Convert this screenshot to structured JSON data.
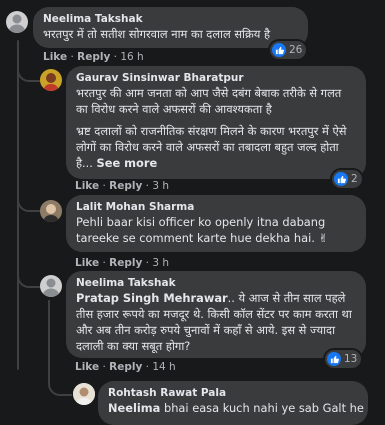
{
  "comments": [
    {
      "author": "Neelima Takshak",
      "text": "भरतपुर में तो सतीश सोगरवाल नाम का दलाल सक्रिय है",
      "like_label": "Like",
      "reply_label": "Reply",
      "time": "16 h",
      "reactions": "26"
    },
    {
      "author": "Gaurav Sinsinwar Bharatpur",
      "paragraph1": "भरतपुर की आम जनता को आप जैसे दबंग बेबाक तरीके से गलत का विरोध करने वाले अफसरों की आवश्यकता है",
      "paragraph2": "भ्रष्ट दलालों को राजनीतिक संरक्षण मिलने के कारण भरतपुर में ऐसे लोगों का विरोध करने वाले अफसरों का तबादला बहुत जल्द होता है...",
      "see_more": "See more",
      "like_label": "Like",
      "reply_label": "Reply",
      "time": "3 h",
      "reactions": "2"
    },
    {
      "author": "Lalit Mohan Sharma",
      "text": "Pehli baar kisi officer ko openly itna dabang tareeke se comment karte hue dekha hai. ✌",
      "like_label": "Like",
      "reply_label": "Reply",
      "time": "3 h"
    },
    {
      "author": "Neelima Takshak",
      "mention": "Pratap Singh Mehrawar",
      "text": ".. ये आज से तीन साल पहले तीस हजार रूपये का मजदूर थे. किसी कॉल सेंटर पर काम करता था और अब तीन करोड़ रुपये चुनावों में कहाँ से आये. इस से ज्यादा दलाली का क्या सबूत होगा?",
      "like_label": "Like",
      "reply_label": "Reply",
      "time": "14 h",
      "reactions": "13"
    },
    {
      "author": "Rohtash Rawat Pala",
      "mention": "Neelima",
      "text": " bhai easa kuch nahi ye sab Galt he"
    }
  ],
  "colors": {
    "background": "#18191a",
    "bubble": "#3a3b3c",
    "like_blue": "#1877f2",
    "secondary_text": "#b0b3b8"
  }
}
